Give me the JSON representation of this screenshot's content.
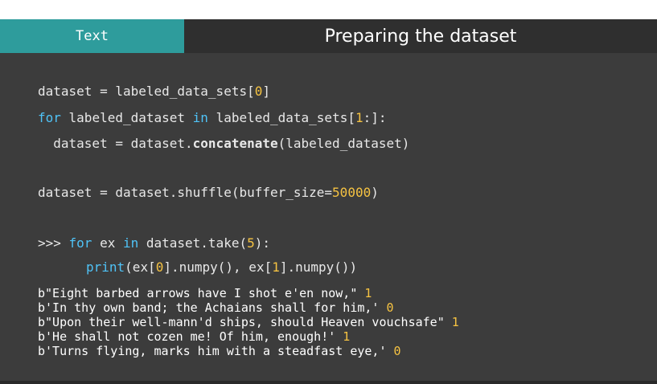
{
  "header": {
    "tab_label": "Text",
    "title": "Preparing the dataset"
  },
  "code": {
    "line1": {
      "a": "dataset = labeled_data_sets[",
      "b": "0",
      "c": "]"
    },
    "line2": {
      "kw1": "for",
      "a": " labeled_dataset ",
      "kw2": "in",
      "b": " labeled_data_sets[",
      "n": "1",
      "c": ":]:"
    },
    "line3": {
      "a": "  dataset = dataset.",
      "b": "concatenate",
      "c": "(labeled_dataset)"
    },
    "line4": {
      "a": "dataset = dataset.shuffle(buffer_size=",
      "n": "50000",
      "c": ")"
    },
    "line5": {
      "prompt": ">>> ",
      "kw1": "for",
      "a": " ex ",
      "kw2": "in",
      "b": " dataset.take(",
      "n": "5",
      "c": "):"
    },
    "line6": {
      "kw": "print",
      "a": "(ex[",
      "n1": "0",
      "b": "].numpy(), ex[",
      "n2": "1",
      "c": "].numpy())"
    }
  },
  "output": [
    {
      "text": "b\"Eight barbed arrows have I shot e'en now,\" ",
      "label": "1"
    },
    {
      "text": "b'In thy own band; the Achaians shall for him,' ",
      "label": "0"
    },
    {
      "text": "b\"Upon their well-mann'd ships, should Heaven vouchsafe\" ",
      "label": "1"
    },
    {
      "text": "b'He shall not cozen me! Of him, enough!' ",
      "label": "1"
    },
    {
      "text": "b'Turns flying, marks him with a steadfast eye,' ",
      "label": "0"
    }
  ],
  "colors": {
    "tab": "#2e9c9c",
    "background": "#3c3c3c",
    "keyword": "#4fc3f7",
    "number": "#f6c342"
  }
}
